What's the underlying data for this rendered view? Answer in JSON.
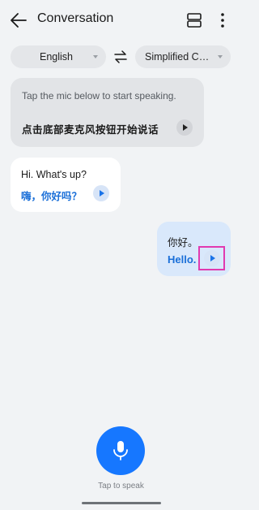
{
  "header": {
    "title": "Conversation",
    "back_icon": "arrow-left-icon",
    "layout_icon": "split-view-icon",
    "more_icon": "more-vertical-icon"
  },
  "languages": {
    "source": "English",
    "target": "Simplified Chinese",
    "swap_icon": "swap-arrows-icon"
  },
  "hint_card": {
    "text": "Tap the mic below to start speaking.",
    "translation": "点击底部麦克风按钮开始说话"
  },
  "messages": [
    {
      "side": "left",
      "original": "Hi. What's up?",
      "translation": "嗨，你好吗？"
    },
    {
      "side": "right",
      "original": "你好。",
      "translation": "Hello."
    }
  ],
  "mic": {
    "label": "Tap to speak",
    "icon": "microphone-icon"
  },
  "colors": {
    "accent": "#1677ff",
    "translation_text": "#1a6fd8",
    "right_bubble": "#d9e8fb",
    "highlight": "#e13ab0"
  }
}
